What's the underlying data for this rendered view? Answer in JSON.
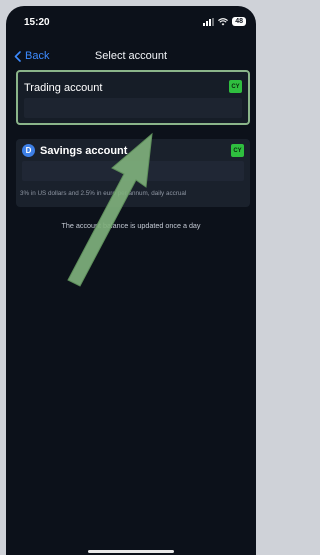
{
  "status_bar": {
    "time": "15:20",
    "battery": "48"
  },
  "nav": {
    "back_label": "Back",
    "title": "Select account"
  },
  "accounts": [
    {
      "title": "Trading account",
      "badge": "CY"
    },
    {
      "title": "Savings account",
      "icon_letter": "D",
      "badge": "CY",
      "rate_note": "3% in US dollars and 2.5% in euro per annum, daily accrual"
    }
  ],
  "info_text": "The account balance is updated once a day",
  "colors": {
    "accent": "#3d8bff",
    "badge": "#2fbf3f",
    "highlight": "#8bb58a",
    "background": "#0c111a"
  }
}
